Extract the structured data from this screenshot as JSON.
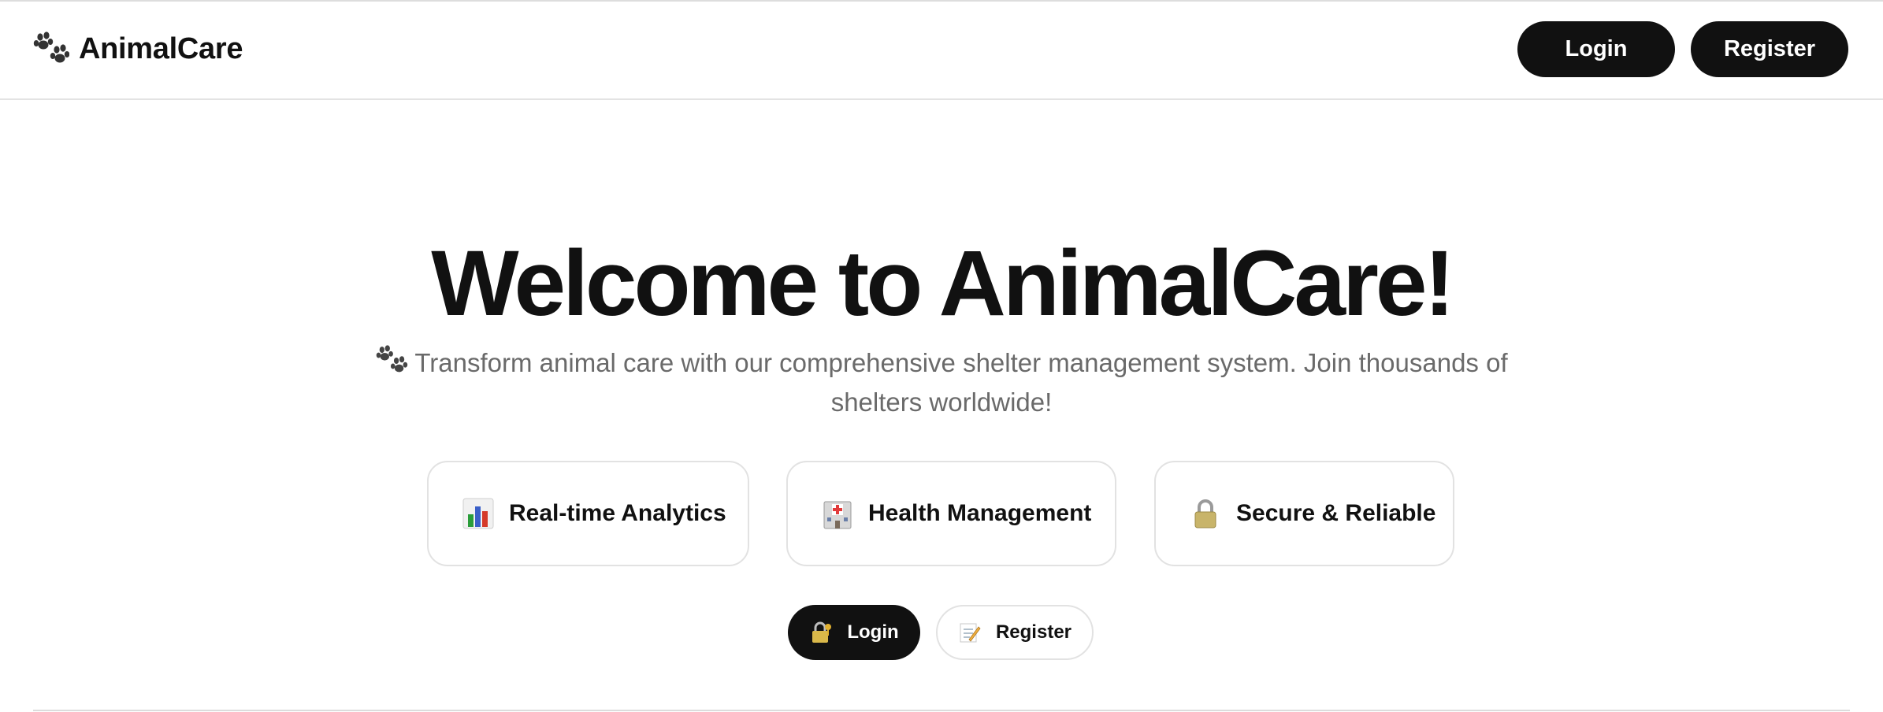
{
  "header": {
    "brand_icon": "paw-prints-icon",
    "brand_name": "AnimalCare",
    "login_label": "Login",
    "register_label": "Register"
  },
  "hero": {
    "title": "Welcome to AnimalCare!",
    "subtitle_icon": "paw-prints-icon",
    "subtitle": "Transform animal care with our comprehensive shelter management system. Join thousands of shelters worldwide!"
  },
  "features": [
    {
      "icon": "bar-chart-icon",
      "label": "Real-time Analytics"
    },
    {
      "icon": "hospital-icon",
      "label": "Health Management"
    },
    {
      "icon": "lock-icon",
      "label": "Secure & Reliable"
    }
  ],
  "cta": {
    "login_icon": "lock-with-key-icon",
    "login_label": "Login",
    "register_icon": "memo-icon",
    "register_label": "Register"
  },
  "colors": {
    "primary": "#111111",
    "text_muted": "#6a6a6a",
    "border": "#e2e2e2",
    "background": "#ffffff"
  }
}
